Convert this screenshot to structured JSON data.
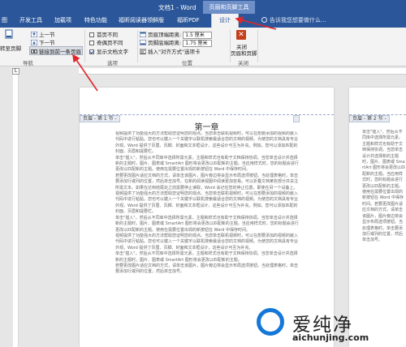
{
  "window": {
    "title": "文档1 - Word",
    "context_tab_label": "页眉和页脚工具"
  },
  "tabs": [
    {
      "label": "图",
      "active": false
    },
    {
      "label": "开发工具",
      "active": false
    },
    {
      "label": "加载项",
      "active": false
    },
    {
      "label": "特色功能",
      "active": false
    },
    {
      "label": "福昕阅读器领鲜版",
      "active": false
    },
    {
      "label": "福昕PDF",
      "active": false
    },
    {
      "label": "设计",
      "active": true
    }
  ],
  "tell_me": "告诉我您想要做什么...",
  "ribbon": {
    "navigation": {
      "goto_footer": "转至页脚",
      "previous": "上一节",
      "next": "下一节",
      "link_to_previous": "链接到前一条页眉",
      "group": "导航"
    },
    "options": {
      "different_first": "首页不同",
      "odd_even_different": "奇偶页不同",
      "show_document_text": "显示文档文字",
      "group": "选项"
    },
    "position": {
      "header_top_label": "页眉顶端距离:",
      "header_top_value": "1.5 厘米",
      "footer_bottom_label": "页脚底端距离:",
      "footer_bottom_value": "1.75 厘米",
      "insert_alignment_tab": "插入\"对齐方式\"选项卡",
      "group": "位置"
    },
    "close": {
      "label_line1": "关闭",
      "label_line2": "页眉和页脚",
      "group": "关闭"
    }
  },
  "ruler_corner": "L",
  "page1": {
    "header_tag": "页眉 - 第 1 节 -",
    "chapter_title": "第一章",
    "paragraphs": [
      "视频提供了功能强大的方法帮助您证明您的观点。当您单击联机视频时，可以在想要添加的视频的嵌入代码中进行粘贴。您也可以键入一个关键字以联机搜索最适合您的文档的视频。为使您的文档具有专业外观，Word 提供了页眉、页脚、封面和文本框设计，这些设计可互为补充。例如，您可以添加匹配的封面、页眉和提要栏。",
      "单击\"插入\"，然后从不同库中选择所需元素。主题和样式也有助于文档保持协调。当您单击设计并选择新的主题时，图片、图表或 SmartArt 图形将会更改以匹配新的主题。当应用样式时，您的标题会进行更改以匹配新的主题。使用在需要位置出现的新按钮在 Word 中保存时间。",
      "若要更改图片适应文档的方式，请单击该图片，图片旁边将会显示布局选项按钮。当处理表格时，单击要添加行或列的位置，然后单击加号。在新的阅读视图中阅读更加容易。可以折叠文档某些部分并关注所需文本。如果在达到结尾处之前需要停止读取，Word 会记住您的停止位置，即使在另一个设备上。",
      "视频提供了功能强大的方法帮助您证明您的观点。当您单击联机视频时，可以在想要添加的视频的嵌入代码中进行粘贴。您也可以键入一个关键字以联机搜索最适合您的文档的视频。为使您的文档具有专业外观，Word 提供了页眉、页脚、封面和文本框设计，这些设计可互为补充。例如，您可以添加匹配的封面、页眉和提要栏。",
      "单击\"插入\"，然后从不同库中选择所需元素。主题和样式也有助于文档保持协调。当您单击设计并选择新的主题时，图片、图表或 SmartArt 图形将会更改以匹配新的主题。当应用样式时，您的标题会进行更改以匹配新的主题。使用在需要位置出现的新按钮在 Word 中保存时间。",
      "视频提供了功能强大的方法帮助您证明您的观点。当您单击联机视频时，可以在想要添加的视频的嵌入代码中进行粘贴。您也可以键入一个关键字以联机搜索最适合您的文档的视频。为使您的文档具有专业外观，Word 提供了页眉、页脚、封面和文本框设计，这些设计可互为补充。",
      "单击\"插入\"，然后从不同库中选择所需元素。主题和样式也有助于文档保持协调。当您单击设计并选择新的主题时，图片、图表或 SmartArt 图形将会更改以匹配新的主题。",
      "若要更改图片适应文档的方式，请单击该图片，图片旁边将会显示布局选项按钮。当处理表格时，单击要添加行或列的位置，然后单击加号。"
    ]
  },
  "page2": {
    "header_tag": "页眉 - 第 2 节 -",
    "paragraphs": [
      "单击\"插入\"，然后从不同库中选择所需元素。主题和样式也有助于文档保持协调。当您单击设计并选择新的主题时，图片、图表或 SmartArt 图形将会更改以匹配新的主题。当应用样式时，您的标题会进行更改以匹配新的主题。使用在需要位置出现的新按钮在 Word 中保存时间。若要更改图片适应文档的方式，请单击该图片，图片旁边将会显示布局选项按钮。当处理表格时，单击要添加行或列的位置，然后单击加号。"
    ]
  },
  "watermark": {
    "text": "爱纯净",
    "url": "aichunjing.com"
  },
  "colors": {
    "word_blue": "#2b579a",
    "annotation_red": "#e0262a",
    "watermark_blue": "#1578d9"
  }
}
